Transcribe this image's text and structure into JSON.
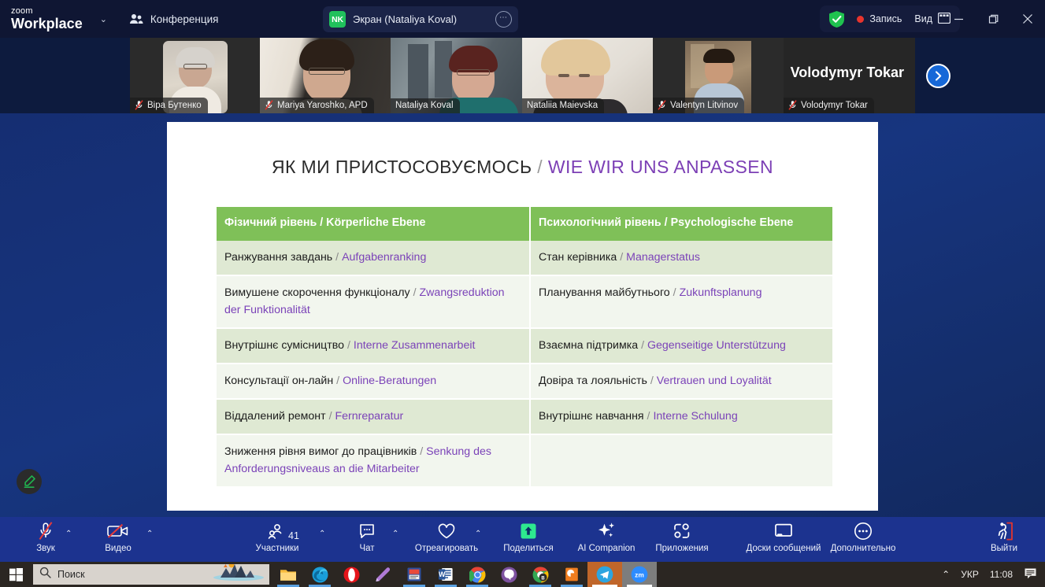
{
  "titlebar": {
    "logo_top": "zoom",
    "logo_bottom": "Workplace",
    "chevron": "⌄",
    "meeting_label": "Конференция",
    "share_badge": "NK",
    "share_label": "Экран (Nataliya Koval)",
    "share_more": "⋯",
    "recording_label": "Запись",
    "view_label": "Вид",
    "minimize": "—",
    "maximize": "❐",
    "close": "✕"
  },
  "filmstrip": {
    "participants": [
      {
        "name": "Віра Бутенко",
        "muted": true,
        "active": false
      },
      {
        "name": "Mariya Yaroshko, APD",
        "muted": true,
        "active": false
      },
      {
        "name": "Nataliya Koval",
        "muted": false,
        "active": true
      },
      {
        "name": "Nataliia Maievska",
        "muted": false,
        "active": false
      },
      {
        "name": "Valentyn Litvinov",
        "muted": true,
        "active": false
      },
      {
        "name": "Volodymyr Tokar",
        "muted": true,
        "active": false
      }
    ],
    "spotlight_name": "Volodymyr Tokar",
    "next_arrow": "›"
  },
  "slide": {
    "title_ua": "ЯК МИ ПРИСТОСОВУЄМОСЬ",
    "title_sep": "/",
    "title_de": "WIE WIR UNS ANPASSEN",
    "header_color": "#7fc058",
    "accent_color": "#7b43b8",
    "columns": [
      "Фізичний рівень / Körperliche Ebene",
      "Психологічний рівень / Psychologische Ebene"
    ],
    "rows": [
      {
        "left_ua": "Ранжування завдань",
        "left_de": "Aufgabenranking",
        "right_ua": "Стан керівника",
        "right_de": "Managerstatus"
      },
      {
        "left_ua": "Вимушене скорочення функціоналу",
        "left_de": "Zwangsreduktion der Funktionalität",
        "right_ua": "Планування майбутнього",
        "right_de": "Zukunftsplanung"
      },
      {
        "left_ua": "Внутрішнє сумісництво",
        "left_de": "Interne Zusammenarbeit",
        "right_ua": "Взаємна підтримка",
        "right_de": "Gegenseitige Unterstützung"
      },
      {
        "left_ua": "Консультації он-лайн",
        "left_de": "Online-Beratungen",
        "right_ua": "Довіра та лояльність",
        "right_de": "Vertrauen und Loyalität"
      },
      {
        "left_ua": "Віддалений ремонт",
        "left_de": "Fernreparatur",
        "right_ua": "Внутрішнє навчання ",
        "right_de": "Interne Schulung"
      },
      {
        "left_ua": "Зниження рівня вимог до працівників",
        "left_de": "Senkung des Anforderungsniveaus an die Mitarbeiter",
        "right_ua": "",
        "right_de": ""
      }
    ]
  },
  "toolbar": {
    "audio_label": "Звук",
    "video_label": "Видео",
    "participants_label": "Участники",
    "participants_count": "41",
    "chat_label": "Чат",
    "react_label": "Отреагировать",
    "share_label": "Поделиться",
    "ai_label": "AI Companion",
    "apps_label": "Приложения",
    "whiteboards_label": "Доски сообщений",
    "more_label": "Дополнительно",
    "leave_label": "Выйти",
    "caret": "⌃"
  },
  "taskbar": {
    "search_placeholder": "Поиск",
    "tray_chevron": "⌃",
    "language": "УКР",
    "clock": "11:08"
  }
}
